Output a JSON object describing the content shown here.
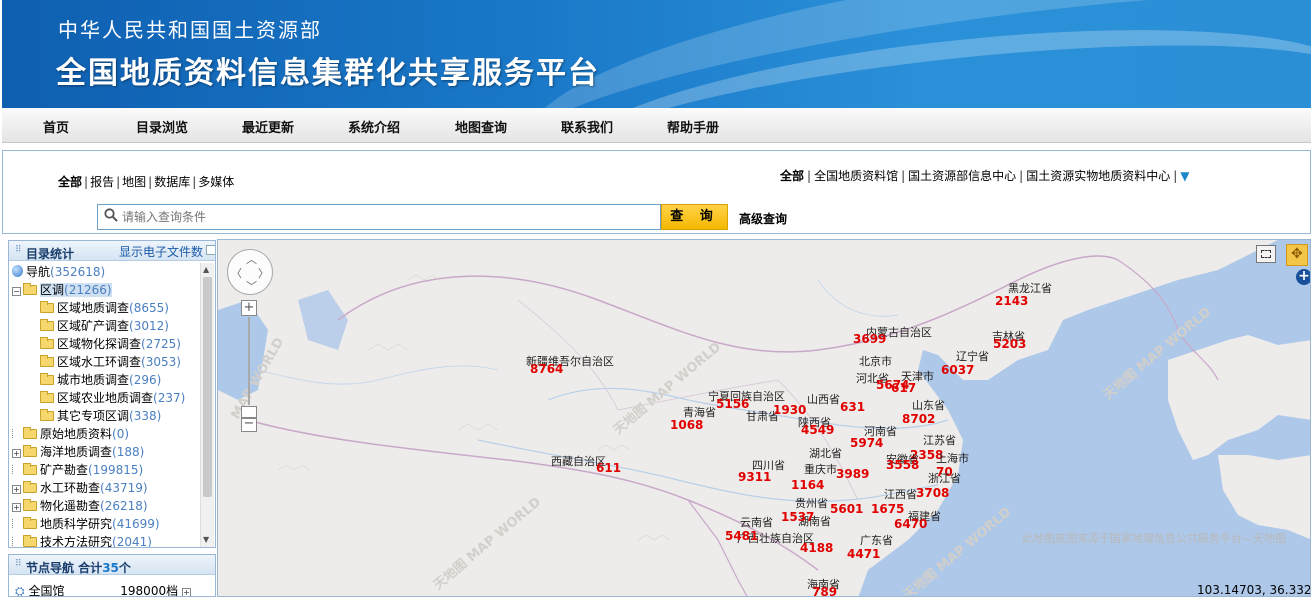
{
  "header": {
    "ministry": "中华人民共和国国土资源部",
    "platform": "全国地质资料信息集群化共享服务平台"
  },
  "nav": [
    "首页",
    "目录浏览",
    "最近更新",
    "系统介绍",
    "地图查询",
    "联系我们",
    "帮助手册"
  ],
  "search": {
    "filters": [
      "全部",
      "报告",
      "地图",
      "数据库",
      "多媒体"
    ],
    "sources": [
      "全部",
      "全国地质资料馆",
      "国土资源部信息中心",
      "国土资源实物地质资料中心"
    ],
    "placeholder": "请输入查询条件",
    "button": "查 询",
    "advanced": "高级查询"
  },
  "catalog": {
    "title": "目录统计",
    "show_files": "显示电子文件数",
    "nav_label": "导航",
    "nav_count": "(352618)",
    "items": [
      {
        "label": "区调",
        "count": "(21266)",
        "level": 0,
        "expand": "−"
      },
      {
        "label": "区域地质调查",
        "count": "(8655)",
        "level": 1
      },
      {
        "label": "区域矿产调查",
        "count": "(3012)",
        "level": 1
      },
      {
        "label": "区域物化探调查",
        "count": "(2725)",
        "level": 1
      },
      {
        "label": "区域水工环调查",
        "count": "(3053)",
        "level": 1
      },
      {
        "label": "城市地质调查",
        "count": "(296)",
        "level": 1
      },
      {
        "label": "区域农业地质调查",
        "count": "(237)",
        "level": 1
      },
      {
        "label": "其它专项区调",
        "count": "(338)",
        "level": 1
      },
      {
        "label": "原始地质资料",
        "count": "(0)",
        "level": 0,
        "expand": ""
      },
      {
        "label": "海洋地质调查",
        "count": "(188)",
        "level": 0,
        "expand": "+"
      },
      {
        "label": "矿产勘查",
        "count": "(199815)",
        "level": 0,
        "expand": ""
      },
      {
        "label": "水工环勘查",
        "count": "(43719)",
        "level": 0,
        "expand": "+"
      },
      {
        "label": "物化遥勘查",
        "count": "(26218)",
        "level": 0,
        "expand": "+"
      },
      {
        "label": "地质科学研究",
        "count": "(41699)",
        "level": 0,
        "expand": ""
      },
      {
        "label": "技术方法研究",
        "count": "(2041)",
        "level": 0,
        "expand": ""
      }
    ]
  },
  "nodes": {
    "title": "节点导航 合计",
    "total": "35",
    "unit": "个",
    "first_node": "全国馆",
    "first_count": "198000档"
  },
  "map": {
    "credit": "此地图底图来源于国家地理信息公共服务平台—天地图",
    "coords": "103.14703, 36.33242",
    "labels": [
      {
        "name": "黑龙江省",
        "num": "2143"
      },
      {
        "name": "吉林省",
        "num": "5203"
      },
      {
        "name": "辽宁省",
        "num": "6037"
      },
      {
        "name": "内蒙古自治区",
        "num": "3699"
      },
      {
        "name": "新疆维吾尔自治区",
        "num": "8764"
      },
      {
        "name": "北京市",
        "num": ""
      },
      {
        "name": "河北省",
        "num": "5674"
      },
      {
        "name": "天津市",
        "num": "617"
      },
      {
        "name": "宁夏回族自治区",
        "num": "5156"
      },
      {
        "name": "山西省",
        "num": "631"
      },
      {
        "name": "青海省",
        "num": "1068"
      },
      {
        "name": "甘肃省",
        "num": "1930"
      },
      {
        "name": "陕西省",
        "num": "4549"
      },
      {
        "name": "山东省",
        "num": "8702"
      },
      {
        "name": "河南省",
        "num": "5974"
      },
      {
        "name": "江苏省",
        "num": "2358"
      },
      {
        "name": "西藏自治区",
        "num": "611"
      },
      {
        "name": "湖北省",
        "num": ""
      },
      {
        "name": "安徽省",
        "num": "3558"
      },
      {
        "name": "上海市",
        "num": "70"
      },
      {
        "name": "四川省",
        "num": "9311"
      },
      {
        "name": "重庆市",
        "num": "3989"
      },
      {
        "name": "浙江省",
        "num": "3708"
      },
      {
        "name": "贵州省",
        "num": "1164"
      },
      {
        "name": "江西省",
        "num": "1675"
      },
      {
        "name": "湖南省",
        "num": "5601"
      },
      {
        "name": "福建省",
        "num": "6470"
      },
      {
        "name": "云南省",
        "num": "1537"
      },
      {
        "name": "广西壮族自治区",
        "num": "5481"
      },
      {
        "name": "广东省",
        "num": "4188"
      },
      {
        "name": "海南省",
        "num": "4471"
      },
      {
        "name": "海南",
        "num": "789"
      }
    ]
  },
  "colors": {
    "accent": "#1a78c8",
    "search_button": "#f5b800",
    "map_numbers": "#e00000"
  }
}
